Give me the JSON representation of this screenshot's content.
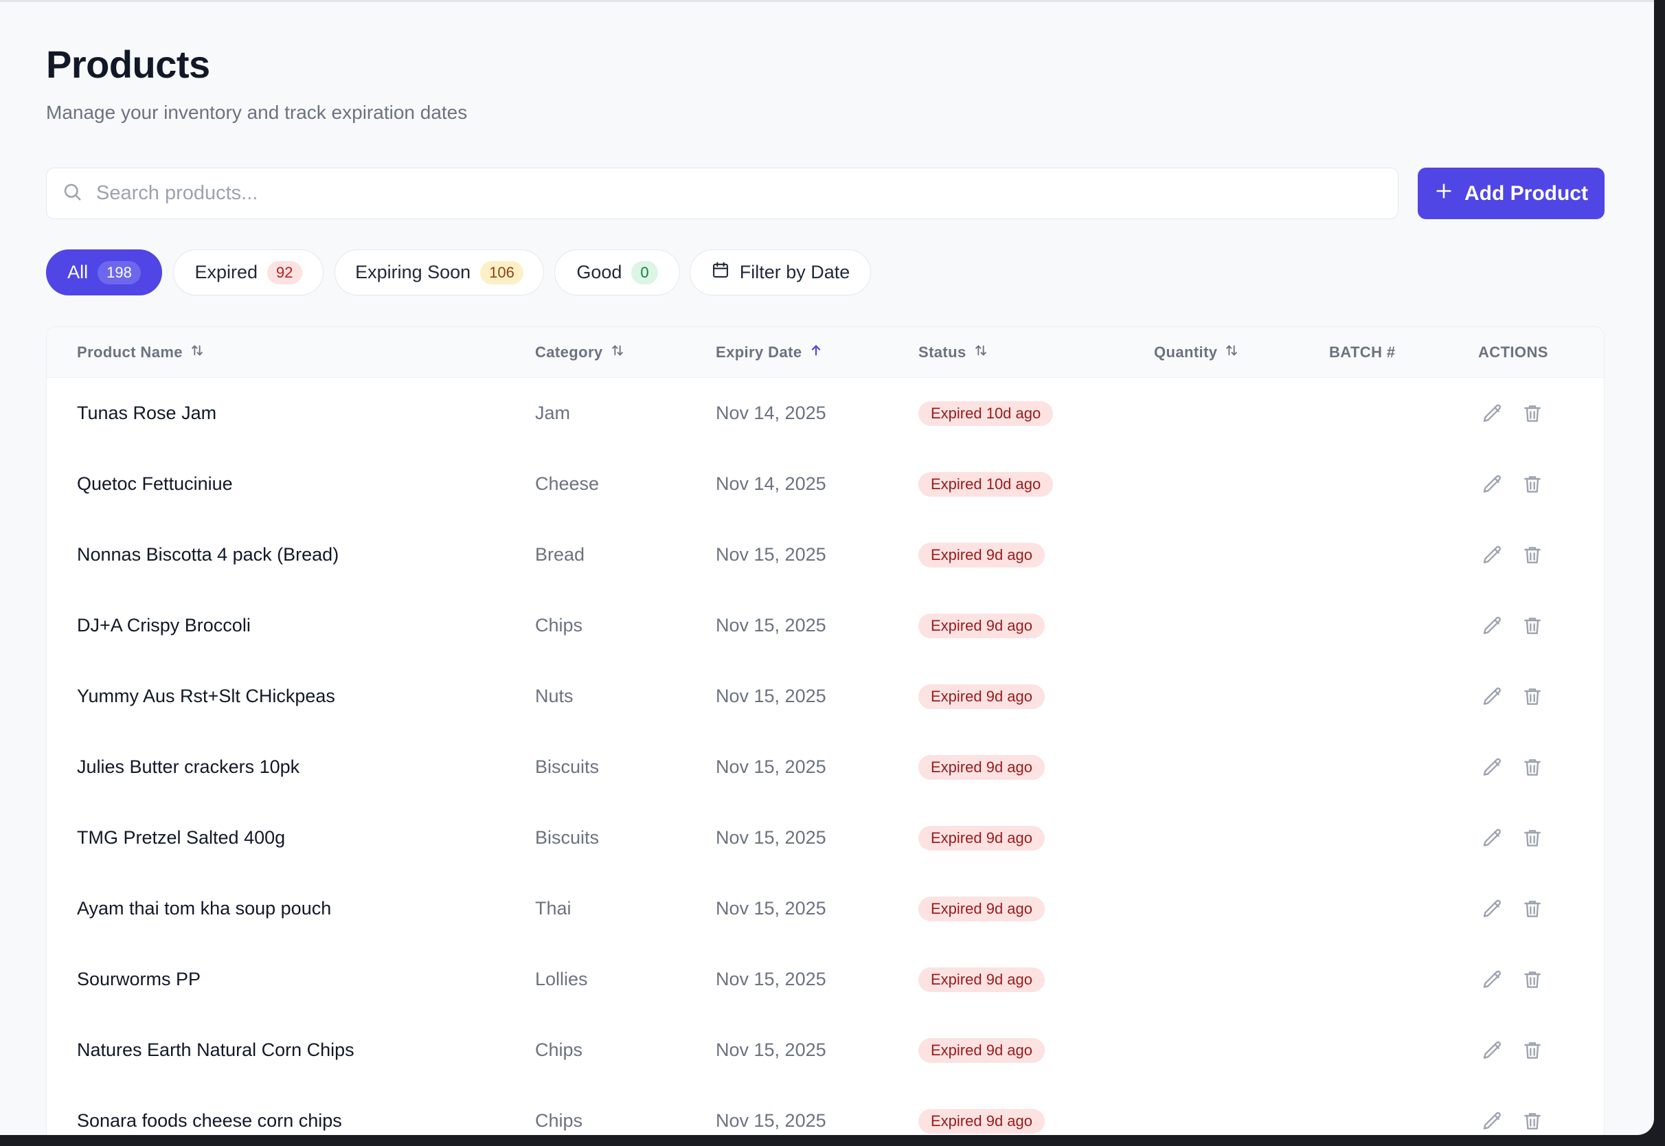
{
  "header": {
    "title": "Products",
    "subtitle": "Manage your inventory and track expiration dates"
  },
  "search": {
    "placeholder": "Search products..."
  },
  "add_button": {
    "label": "Add Product",
    "icon": "plus-icon"
  },
  "filters": [
    {
      "label": "All",
      "count": "198",
      "active": true
    },
    {
      "label": "Expired",
      "count": "92",
      "tone": "red"
    },
    {
      "label": "Expiring Soon",
      "count": "106",
      "tone": "amber"
    },
    {
      "label": "Good",
      "count": "0",
      "tone": "green"
    },
    {
      "label": "Filter by Date",
      "icon": "calendar-icon"
    }
  ],
  "table": {
    "columns": [
      {
        "label": "Product Name",
        "sort": "both"
      },
      {
        "label": "Category",
        "sort": "both"
      },
      {
        "label": "Expiry Date",
        "sort": "asc"
      },
      {
        "label": "Status",
        "sort": "both"
      },
      {
        "label": "Quantity",
        "sort": "both"
      },
      {
        "label": "BATCH #"
      },
      {
        "label": "ACTIONS"
      }
    ],
    "rows": [
      {
        "name": "Tunas Rose Jam",
        "category": "Jam",
        "expiry": "Nov 14, 2025",
        "status": "Expired 10d ago",
        "quantity": "",
        "batch": ""
      },
      {
        "name": "Quetoc Fettuciniue",
        "category": "Cheese",
        "expiry": "Nov 14, 2025",
        "status": "Expired 10d ago",
        "quantity": "",
        "batch": ""
      },
      {
        "name": "Nonnas Biscotta 4 pack (Bread)",
        "category": "Bread",
        "expiry": "Nov 15, 2025",
        "status": "Expired 9d ago",
        "quantity": "",
        "batch": ""
      },
      {
        "name": "DJ+A Crispy Broccoli",
        "category": "Chips",
        "expiry": "Nov 15, 2025",
        "status": "Expired 9d ago",
        "quantity": "",
        "batch": ""
      },
      {
        "name": "Yummy Aus Rst+Slt CHickpeas",
        "category": "Nuts",
        "expiry": "Nov 15, 2025",
        "status": "Expired 9d ago",
        "quantity": "",
        "batch": ""
      },
      {
        "name": "Julies Butter crackers 10pk",
        "category": "Biscuits",
        "expiry": "Nov 15, 2025",
        "status": "Expired 9d ago",
        "quantity": "",
        "batch": ""
      },
      {
        "name": "TMG Pretzel Salted 400g",
        "category": "Biscuits",
        "expiry": "Nov 15, 2025",
        "status": "Expired 9d ago",
        "quantity": "",
        "batch": ""
      },
      {
        "name": "Ayam thai tom kha soup pouch",
        "category": "Thai",
        "expiry": "Nov 15, 2025",
        "status": "Expired 9d ago",
        "quantity": "",
        "batch": ""
      },
      {
        "name": "Sourworms PP",
        "category": "Lollies",
        "expiry": "Nov 15, 2025",
        "status": "Expired 9d ago",
        "quantity": "",
        "batch": ""
      },
      {
        "name": "Natures Earth Natural Corn Chips",
        "category": "Chips",
        "expiry": "Nov 15, 2025",
        "status": "Expired 9d ago",
        "quantity": "",
        "batch": ""
      },
      {
        "name": "Sonara foods cheese corn chips",
        "category": "Chips",
        "expiry": "Nov 15, 2025",
        "status": "Expired 9d ago",
        "quantity": "",
        "batch": ""
      }
    ]
  },
  "colors": {
    "accent": "#4f46e5",
    "expired_bg": "#fde2e2",
    "expired_text": "#991b1b"
  }
}
